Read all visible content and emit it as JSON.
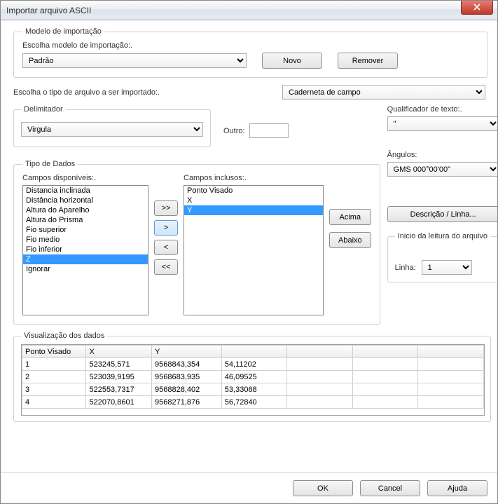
{
  "window": {
    "title": "Importar arquivo ASCII"
  },
  "model": {
    "legend": "Modelo de importação",
    "label": "Escolha modelo de importação:.",
    "value": "Padrão",
    "new_btn": "Novo",
    "remove_btn": "Remover"
  },
  "file_type": {
    "label": "Escolha o tipo de arquivo a ser importado:.",
    "value": "Caderneta de campo"
  },
  "delimiter": {
    "legend": "Delimitador",
    "value": "Virgula",
    "other_label": "Outro:",
    "other_value": ""
  },
  "text_qualifier": {
    "label": "Qualificador de texto:.",
    "value": "\""
  },
  "data_type": {
    "legend": "Tipo de Dados",
    "available_label": "Campos disponíveis:.",
    "available": [
      "Distancia inclinada",
      "Distância horizontal",
      "Altura do Aparelho",
      "Altura do Prisma",
      "Fio superior",
      "Fio medio",
      "Fio inferior",
      "Z",
      "Ignorar"
    ],
    "available_selected": "Z",
    "included_label": "Campos inclusos:.",
    "included": [
      "Ponto Visado",
      "X",
      "Y"
    ],
    "included_selected": "Y",
    "move_all_right": ">>",
    "move_right": ">",
    "move_left": "<",
    "move_all_left": "<<",
    "up_btn": "Acima",
    "down_btn": "Abaixo"
  },
  "angles": {
    "label": "Ângulos:",
    "value": "GMS 000°00'00\""
  },
  "description_btn": "Descrição / Linha...",
  "start": {
    "legend": "Inicio da leitura do arquivo",
    "label": "Linha:",
    "value": "1"
  },
  "preview": {
    "legend": "Visualização dos dados",
    "headers": [
      "Ponto Visado",
      "X",
      "Y",
      "",
      "",
      "",
      ""
    ],
    "rows": [
      [
        "1",
        "523245,571",
        "9568843,354",
        "54,11202",
        "",
        "",
        ""
      ],
      [
        "2",
        "523039,9195",
        "9568683,935",
        "46,09525",
        "",
        "",
        ""
      ],
      [
        "3",
        "522553,7317",
        "9568828,402",
        "53,33068",
        "",
        "",
        ""
      ],
      [
        "4",
        "522070,8601",
        "9568271,876",
        "56,72840",
        "",
        "",
        ""
      ]
    ]
  },
  "footer": {
    "ok": "OK",
    "cancel": "Cancel",
    "help": "Ajuda"
  }
}
